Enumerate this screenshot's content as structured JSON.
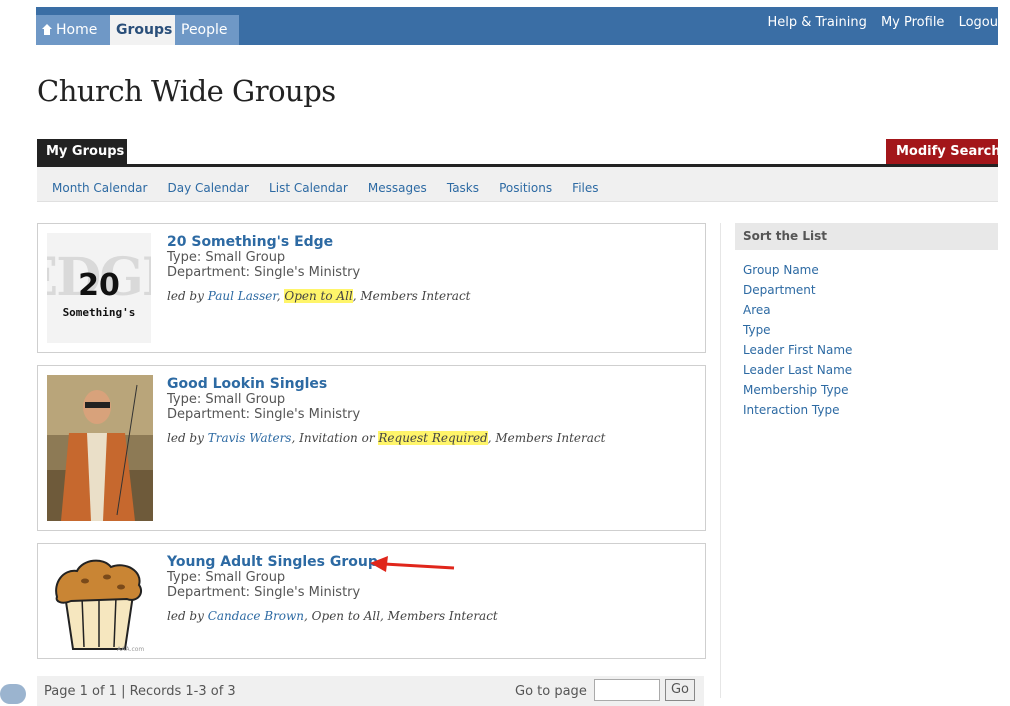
{
  "topnav": {
    "tabs": [
      "Home",
      "Groups",
      "People"
    ],
    "links": [
      "Help & Training",
      "My Profile",
      "Logou"
    ]
  },
  "page_title": "Church Wide Groups",
  "tabs": {
    "my_groups": "My Groups",
    "modify_search": "Modify Search"
  },
  "subnav": [
    "Month Calendar",
    "Day Calendar",
    "List Calendar",
    "Messages",
    "Tasks",
    "Positions",
    "Files"
  ],
  "groups": [
    {
      "name": "20 Something's Edge",
      "type": "Type: Small Group",
      "department": "Department: Single's Ministry",
      "led_prefix": "led by ",
      "leader": "Paul Lasser",
      "sep1": ", ",
      "access": "Open to All",
      "sep2": ", Members Interact",
      "thumb_text": {
        "edge": "EDGE",
        "num": "20",
        "word": "Something's"
      }
    },
    {
      "name": "Good Lookin Singles",
      "type": "Type: Small Group",
      "department": "Department: Single's Ministry",
      "led_prefix": "led by ",
      "leader": "Travis Waters",
      "sep1": ", Invitation or ",
      "access": "Request Required",
      "sep2": ", Members Interact"
    },
    {
      "name": "Young Adult Singles Group",
      "type": "Type: Small Group",
      "department": "Department: Single's Ministry",
      "led_prefix": "led by ",
      "leader": "Candace Brown",
      "sep1": ", Open to All, Members Interact",
      "thumb_caption": "AAA.com"
    }
  ],
  "sidebar": {
    "title": "Sort the List",
    "items": [
      "Group Name",
      "Department",
      "Area",
      "Type",
      "Leader First Name",
      "Leader Last Name",
      "Membership Type",
      "Interaction Type"
    ]
  },
  "pager": {
    "info": "Page 1 of 1  |  Records 1-3 of 3",
    "goto_label": "Go to page",
    "go_button": "Go"
  },
  "colors": {
    "nav": "#3a6ea5",
    "modify": "#a3161a",
    "link": "#2d6aa3",
    "highlight": "#fff56a",
    "arrow": "#e0261b"
  }
}
